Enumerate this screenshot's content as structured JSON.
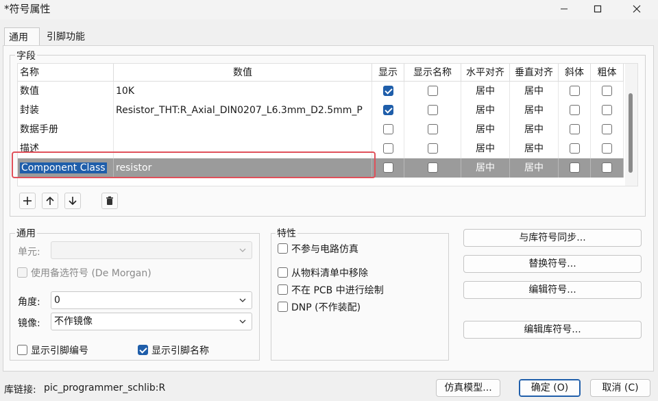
{
  "window": {
    "title": "*符号属性"
  },
  "tabs": [
    {
      "label": "通用"
    },
    {
      "label": "引脚功能"
    }
  ],
  "fields_group": {
    "title": "字段"
  },
  "table": {
    "headers": {
      "name": "名称",
      "value": "数值",
      "show": "显示",
      "show_name": "显示名称",
      "h_align": "水平对齐",
      "v_align": "垂直对齐",
      "italic": "斜体",
      "bold": "粗体"
    },
    "rows": [
      {
        "name": "数值",
        "value": "10K",
        "show": true,
        "show_name": false,
        "h_align": "居中",
        "v_align": "居中",
        "italic": false,
        "bold": false
      },
      {
        "name": "封装",
        "value": "Resistor_THT:R_Axial_DIN0207_L6.3mm_D2.5mm_P",
        "show": true,
        "show_name": false,
        "h_align": "居中",
        "v_align": "居中",
        "italic": false,
        "bold": false
      },
      {
        "name": "数据手册",
        "value": "",
        "show": false,
        "show_name": false,
        "h_align": "居中",
        "v_align": "居中",
        "italic": false,
        "bold": false
      },
      {
        "name": "描述",
        "value": "",
        "show": false,
        "show_name": false,
        "h_align": "居中",
        "v_align": "居中",
        "italic": false,
        "bold": false
      },
      {
        "name": "Component Class",
        "value": "resistor",
        "show": false,
        "show_name": false,
        "h_align": "居中",
        "v_align": "居中",
        "italic": false,
        "bold": false
      }
    ]
  },
  "general": {
    "title": "通用",
    "unit_label": "单元:",
    "demorgan_label": "使用备选符号 (De Morgan)",
    "angle_label": "角度:",
    "angle_value": "0",
    "mirror_label": "镜像:",
    "mirror_value": "不作镜像",
    "show_pin_number": "显示引脚编号",
    "show_pin_name": "显示引脚名称"
  },
  "attributes": {
    "title": "特性",
    "exclude_sim": "不参与电路仿真",
    "exclude_bom": "从物料清单中移除",
    "exclude_pcb": "不在 PCB 中进行绘制",
    "dnp": "DNP (不作装配)"
  },
  "side_buttons": {
    "sync": "与库符号同步...",
    "replace": "替换符号...",
    "edit": "编辑符号...",
    "edit_lib": "编辑库符号..."
  },
  "footer": {
    "lib_link_label": "库链接:",
    "lib_link_value": "pic_programmer_schlib:R",
    "sim_model": "仿真模型...",
    "ok": "确定 (O)",
    "cancel": "取消 (C)"
  },
  "colors": {
    "accent": "#1f5eaa",
    "selected_row": "#9b9b9b",
    "highlight_border": "#e0505a"
  }
}
